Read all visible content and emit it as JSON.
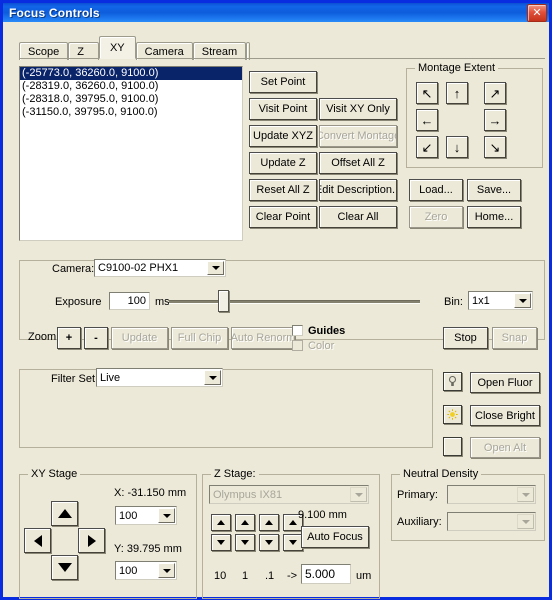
{
  "window": {
    "title": "Focus Controls",
    "close_label": "✕"
  },
  "tabs": [
    {
      "label": "Scope",
      "selected": false
    },
    {
      "label": "Z",
      "selected": false
    },
    {
      "label": "XY",
      "selected": true
    },
    {
      "label": "Camera",
      "selected": false
    },
    {
      "label": "Stream",
      "selected": false
    }
  ],
  "points": {
    "items": [
      "(-25773.0, 36260.0, 9100.0)",
      "(-28319.0, 36260.0, 9100.0)",
      "(-28318.0, 39795.0, 9100.0)",
      "(-31150.0, 39795.0, 9100.0)"
    ],
    "selected_index": 0
  },
  "point_buttons": {
    "set_point": "Set Point",
    "visit_point": "Visit Point",
    "visit_xy_only": "Visit XY Only",
    "update_xyz": "Update XYZ",
    "convert_montage": "Convert Montage",
    "update_z": "Update Z",
    "offset_all_z": "Offset All Z",
    "reset_all_z": "Reset All Z",
    "edit_description": "Edit Description...",
    "clear_point": "Clear Point",
    "clear_all": "Clear All"
  },
  "montage": {
    "legend": "Montage Extent",
    "arrows": {
      "up_left": "↖",
      "up": "↑",
      "up_right": "↗",
      "left": "←",
      "right": "→",
      "down_left": "↙",
      "down": "↓",
      "down_right": "↘"
    }
  },
  "file_buttons": {
    "load": "Load...",
    "save": "Save...",
    "zero": "Zero",
    "home": "Home..."
  },
  "camera": {
    "camera_label": "Camera:",
    "camera_value": "C9100-02 PHX1",
    "exposure_label": "Exposure",
    "exposure_value": "100",
    "exposure_units": "ms",
    "exposure_slider_percent": 21,
    "bin_label": "Bin:",
    "bin_value": "1x1",
    "zoom_label": "Zoom:",
    "zoom_in": "+",
    "zoom_out": "-",
    "update": "Update",
    "full_chip": "Full Chip",
    "auto_renorm": "Auto Renorm",
    "guides": "Guides",
    "color": "Color",
    "stop": "Stop",
    "snap": "Snap"
  },
  "filter": {
    "filter_set_label": "Filter Set:",
    "filter_set_value": "Live",
    "open_fluor": "Open Fluor",
    "close_bright": "Close Bright",
    "open_alt": "Open Alt",
    "icon_lamp": "lamp-icon",
    "icon_bright": "bright-icon",
    "icon_blank": "blank-icon"
  },
  "xy_stage": {
    "legend": "XY Stage",
    "x_readout": "X: -31.150 mm",
    "y_readout": "Y: 39.795 mm",
    "x_step": "100",
    "y_step": "100"
  },
  "z_stage": {
    "legend": "Z Stage:",
    "device": "Olympus IX81",
    "z_readout": "9.100 mm",
    "auto_focus": "Auto Focus",
    "steps": [
      "10",
      "1",
      ".1",
      "->"
    ],
    "step_value": "5.000",
    "step_units": "um"
  },
  "neutral_density": {
    "legend": "Neutral Density",
    "primary_label": "Primary:",
    "primary_value": "",
    "auxiliary_label": "Auxiliary:",
    "auxiliary_value": ""
  },
  "colors": {
    "title_blue": "#0d5cdc",
    "face": "#ece9d8",
    "selection": "#0a246a",
    "close_red": "#c5331c"
  }
}
